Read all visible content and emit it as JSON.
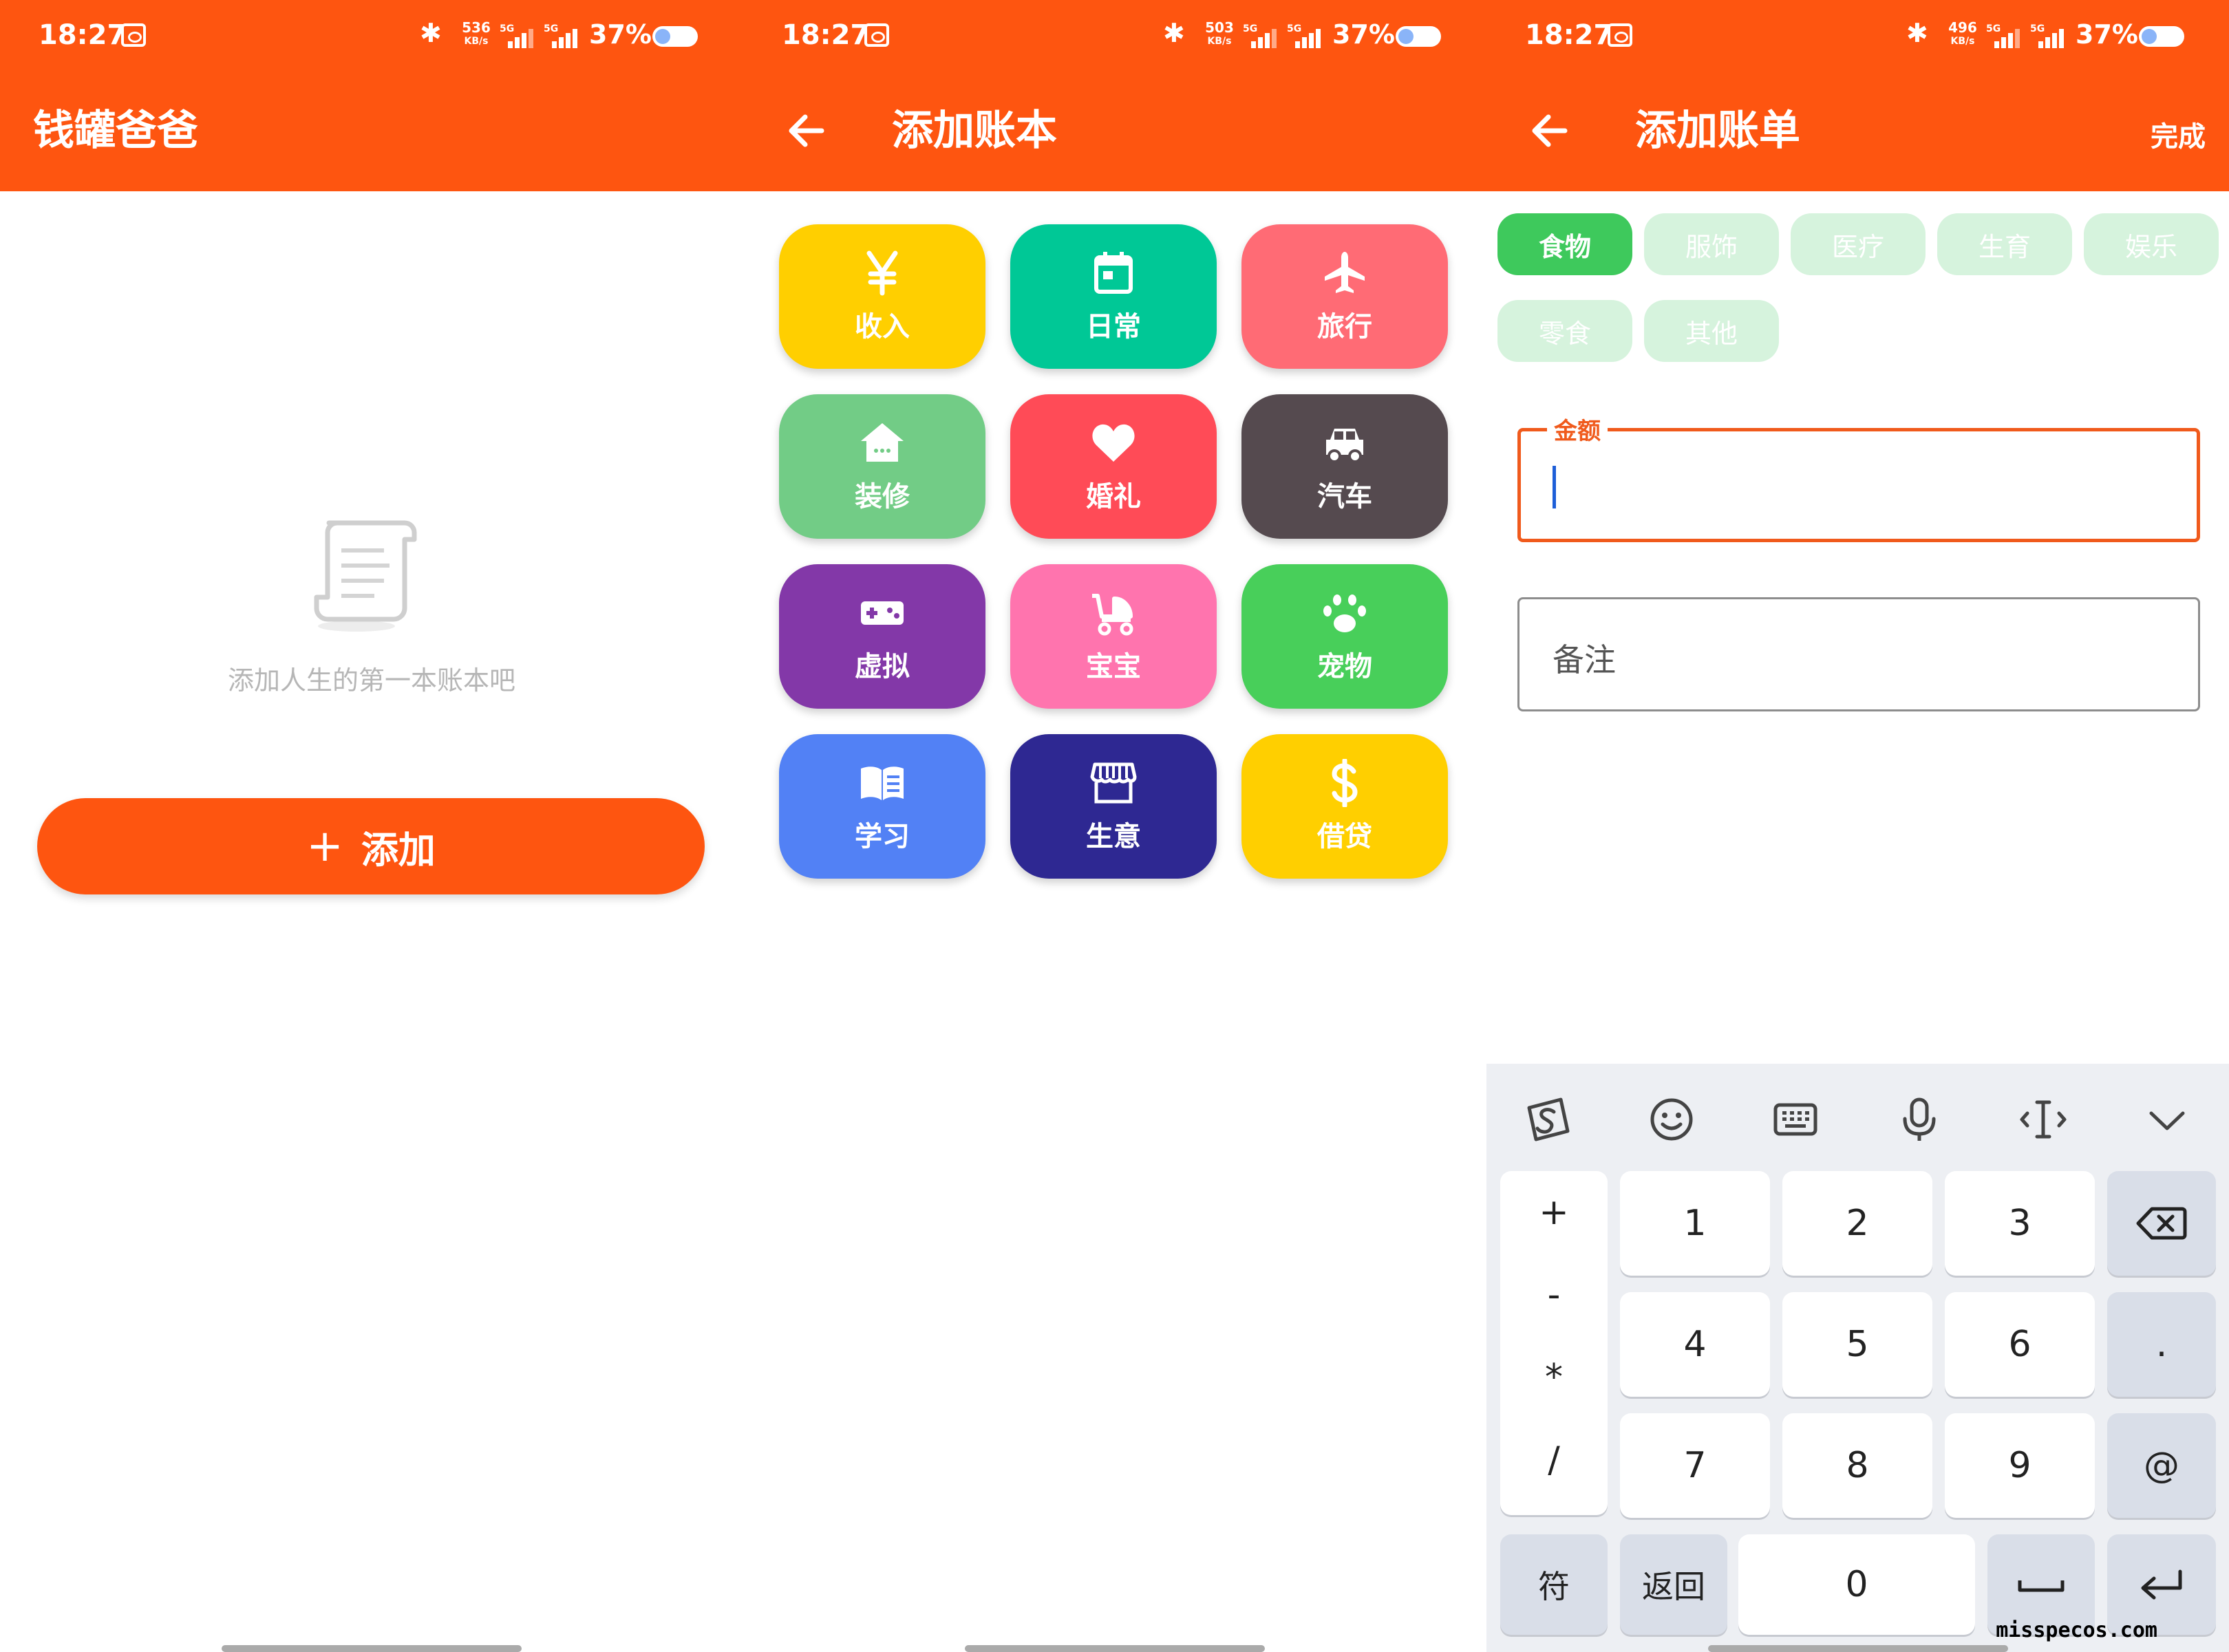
{
  "status_bar": {
    "time": "18:27",
    "battery": "37%",
    "speeds": [
      "536",
      "503",
      "496"
    ],
    "speed_unit": "KB/s",
    "network": "5G"
  },
  "screen1": {
    "title": "钱罐爸爸",
    "empty_text": "添加人生的第一本账本吧",
    "add_plus": "+",
    "add_label": "添加"
  },
  "screen2": {
    "title": "添加账本",
    "tiles": [
      {
        "label": "收入",
        "icon": "yen-icon",
        "color": "#FFCF00"
      },
      {
        "label": "日常",
        "icon": "calendar-icon",
        "color": "#00C896"
      },
      {
        "label": "旅行",
        "icon": "airplane-icon",
        "color": "#FF6B75"
      },
      {
        "label": "装修",
        "icon": "house-icon",
        "color": "#72CC86"
      },
      {
        "label": "婚礼",
        "icon": "heart-icon",
        "color": "#FF4B57"
      },
      {
        "label": "汽车",
        "icon": "car-icon",
        "color": "#554A4F"
      },
      {
        "label": "虚拟",
        "icon": "gamepad-icon",
        "color": "#8338A8"
      },
      {
        "label": "宝宝",
        "icon": "stroller-icon",
        "color": "#FF74AE"
      },
      {
        "label": "宠物",
        "icon": "paw-icon",
        "color": "#48CF5A"
      },
      {
        "label": "学习",
        "icon": "book-icon",
        "color": "#5281F5"
      },
      {
        "label": "生意",
        "icon": "store-icon",
        "color": "#2E2892"
      },
      {
        "label": "借贷",
        "icon": "dollar-icon",
        "color": "#FFCF00"
      }
    ]
  },
  "screen3": {
    "title": "添加账单",
    "done": "完成",
    "categories": [
      "食物",
      "服饰",
      "医疗",
      "生育",
      "娱乐",
      "零食",
      "其他"
    ],
    "selected_category": "食物",
    "amount_label": "金额",
    "amount_value": "",
    "note_placeholder": "备注",
    "keyboard": {
      "symbols": [
        "+",
        "-",
        "*",
        "/"
      ],
      "digits": [
        "1",
        "2",
        "3",
        "4",
        "5",
        "6",
        "7",
        "8",
        "9"
      ],
      "dot": ".",
      "at": "@",
      "fu": "符",
      "back": "返回",
      "zero": "0"
    }
  },
  "watermark": "misspecos.com"
}
